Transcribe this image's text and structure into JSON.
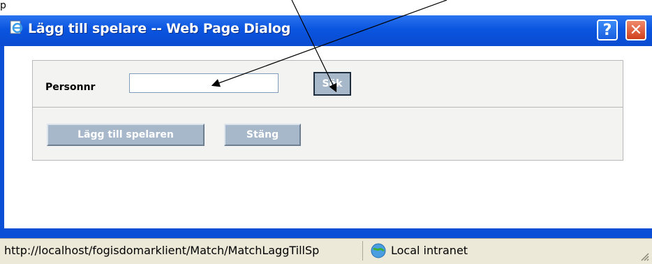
{
  "window": {
    "title": "Lägg till spelare -- Web Page Dialog",
    "help_label": "?",
    "close_label": "✕"
  },
  "form": {
    "personnr_label": "Personnr",
    "personnr_value": "",
    "sok_label": "Sök",
    "add_label": "Lägg till spelaren",
    "close_label": "Stäng"
  },
  "statusbar": {
    "url": "http://localhost/fogisdomarklient/Match/MatchLaggTillSp",
    "zone": "Local intranet"
  },
  "colors": {
    "titlebar": "#0a55e0",
    "button": "#a7b8cb",
    "panel": "#f3f3f1"
  }
}
